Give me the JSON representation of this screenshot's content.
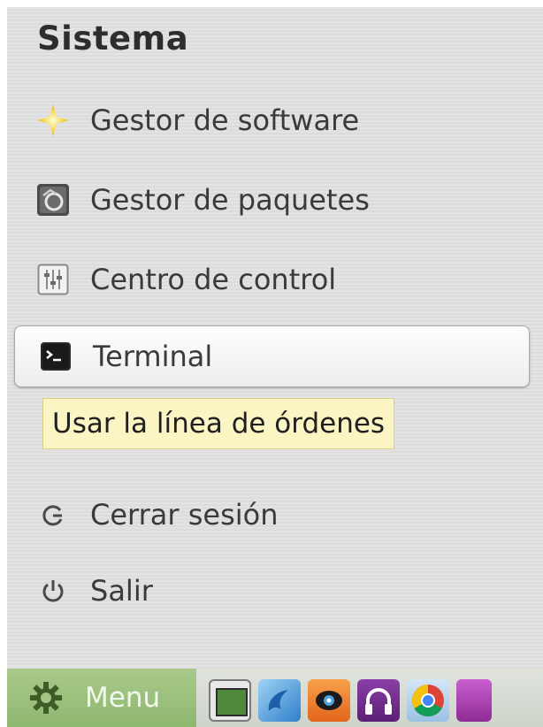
{
  "menu": {
    "section_title": "Sistema",
    "items": [
      {
        "label": "Gestor de software",
        "icon": "star-icon"
      },
      {
        "label": "Gestor de paquetes",
        "icon": "package-manager-icon"
      },
      {
        "label": "Centro de control",
        "icon": "control-center-icon"
      },
      {
        "label": "Terminal",
        "icon": "terminal-icon"
      },
      {
        "label": "Cerrar sesión",
        "icon": "logout-icon"
      },
      {
        "label": "Salir",
        "icon": "power-icon"
      }
    ],
    "tooltip": "Usar la línea de órdenes"
  },
  "taskbar": {
    "menu_label": "Menu",
    "launchers": [
      {
        "icon": "show-desktop-icon"
      },
      {
        "icon": "blue-swirl-app-icon"
      },
      {
        "icon": "media-player-icon"
      },
      {
        "icon": "headphones-icon"
      },
      {
        "icon": "chrome-browser-icon"
      },
      {
        "icon": "purple-app-icon"
      }
    ]
  },
  "colors": {
    "tooltip_bg": "#fbf5c4",
    "menu_button_bg": "#97bd78",
    "text": "#3a3a3a"
  }
}
